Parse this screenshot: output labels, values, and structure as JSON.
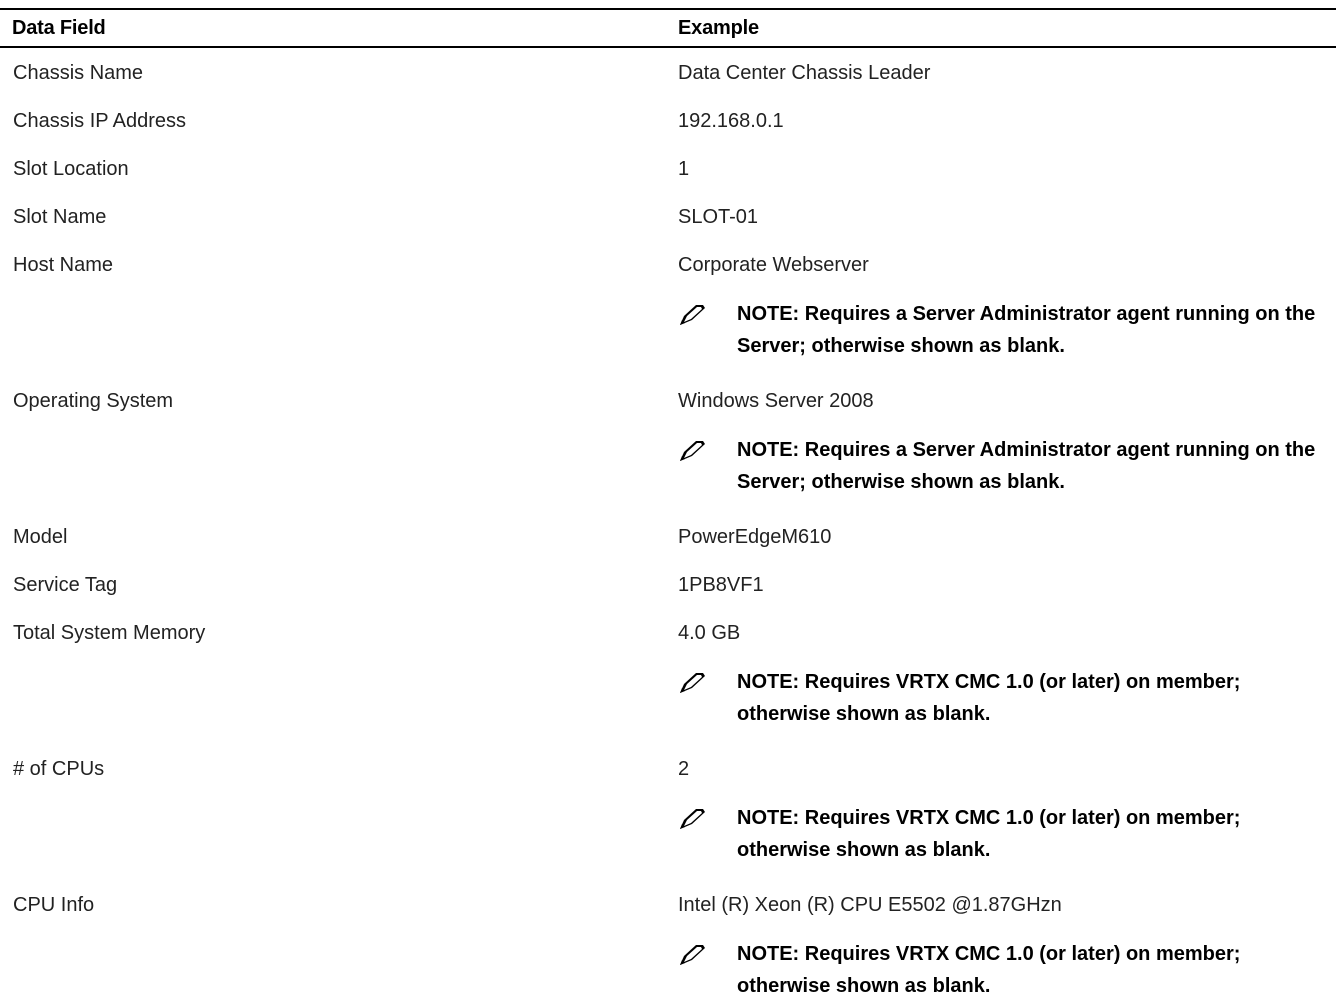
{
  "header": {
    "col1": "Data Field",
    "col2": "Example"
  },
  "rows": [
    {
      "field": "Chassis Name",
      "value": "Data Center Chassis Leader"
    },
    {
      "field": "Chassis IP Address",
      "value": "192.168.0.1"
    },
    {
      "field": "Slot Location",
      "value": "1"
    },
    {
      "field": "Slot Name",
      "value": "SLOT-01"
    },
    {
      "field": "Host Name",
      "value": "Corporate Webserver",
      "note": "NOTE: Requires a Server Administrator agent running on the Server; otherwise shown as blank."
    },
    {
      "field": "Operating System",
      "value": "Windows Server 2008",
      "note": "NOTE: Requires a Server Administrator agent running on the Server; otherwise shown as blank."
    },
    {
      "field": "Model",
      "value": "PowerEdgeM610"
    },
    {
      "field": "Service Tag",
      "value": "1PB8VF1"
    },
    {
      "field": "Total System Memory",
      "value": "4.0 GB",
      "note": "NOTE: Requires VRTX CMC 1.0 (or later) on member; otherwise shown as blank."
    },
    {
      "field": "# of CPUs",
      "value": "2",
      "note": "NOTE: Requires VRTX CMC 1.0 (or later) on member; otherwise shown as blank."
    },
    {
      "field": "CPU Info",
      "value": "Intel (R) Xeon (R) CPU E5502 @1.87GHzn",
      "note": "NOTE: Requires VRTX CMC 1.0 (or later) on member; otherwise shown as blank."
    }
  ],
  "icons": {
    "note": "pencil-note-icon"
  }
}
